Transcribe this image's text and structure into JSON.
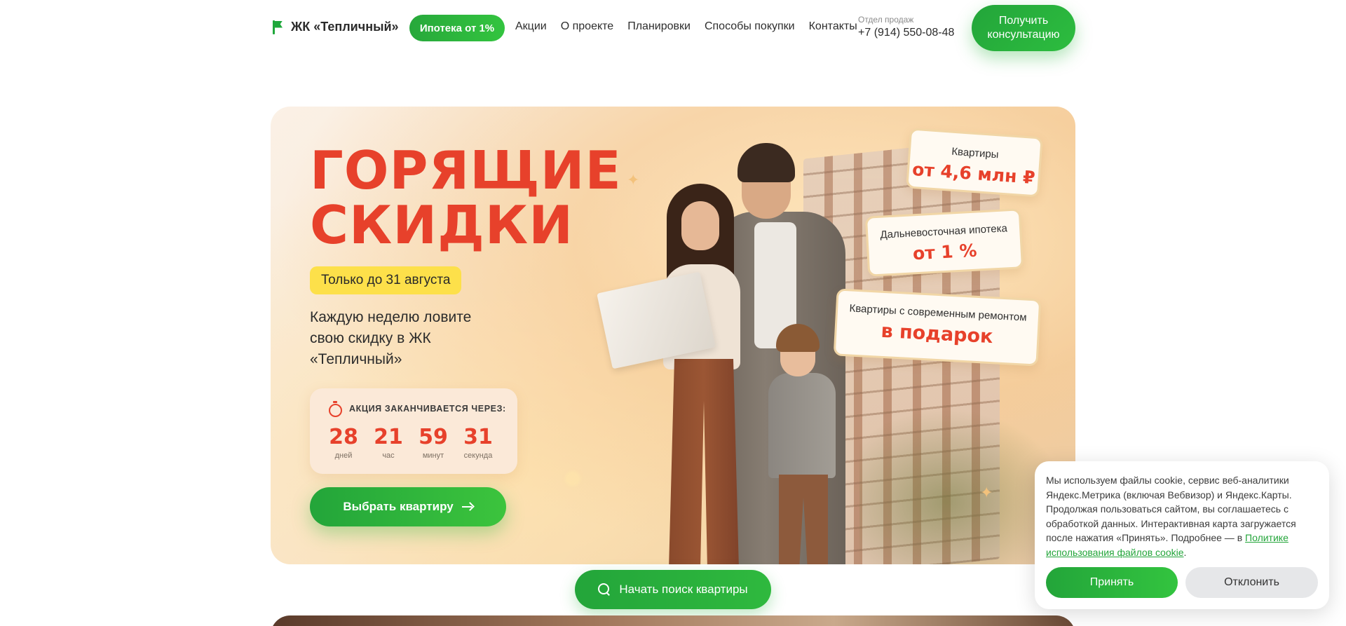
{
  "header": {
    "logo_text": "ЖК «Тепличный»",
    "mortgage_pill": "Ипотека от 1%",
    "nav": [
      "Акции",
      "О проекте",
      "Планировки",
      "Способы покупки",
      "Контакты"
    ],
    "sales_label": "Отдел продаж",
    "sales_phone": "+7 (914) 550-08-48",
    "consult_button": "Получить консультацию"
  },
  "hero": {
    "title_line1": "ГОРЯЩИЕ",
    "title_line2": "СКИДКИ",
    "deadline_badge": "Только до 31 августа",
    "subtitle": "Каждую неделю ловите свою скидку в ЖК «Тепличный»",
    "timer": {
      "label": "АКЦИЯ ЗАКАНЧИВАЕТСЯ ЧЕРЕЗ:",
      "units": [
        {
          "value": "28",
          "caption": "дней"
        },
        {
          "value": "21",
          "caption": "час"
        },
        {
          "value": "59",
          "caption": "минут"
        },
        {
          "value": "31",
          "caption": "секунда"
        }
      ]
    },
    "choose_button": "Выбрать квартиру",
    "cards": [
      {
        "label": "Квартиры",
        "value": "от 4,6 млн ₽"
      },
      {
        "label": "Дальневосточная ипотека",
        "value": "от 1 %"
      },
      {
        "label": "Квартиры с современным ремонтом",
        "value": "в подарок"
      }
    ]
  },
  "search_button": "Начать поиск квартиры",
  "cookie": {
    "text": "Мы используем файлы cookie, сервис веб-аналитики Яндекс.Метрика (включая Вебвизор) и Яндекс.Карты. Продолжая пользоваться сайтом, вы соглашаетесь с обработкой данных. Интерактивная карта загружается после нажатия «Принять». Подробнее — в ",
    "link": "Политике использования файлов cookie",
    "tail": ".",
    "accept": "Принять",
    "decline": "Отклонить"
  },
  "colors": {
    "brand_green": "#23a53a",
    "accent_red": "#e7412b",
    "badge_yellow": "#fde04a"
  }
}
